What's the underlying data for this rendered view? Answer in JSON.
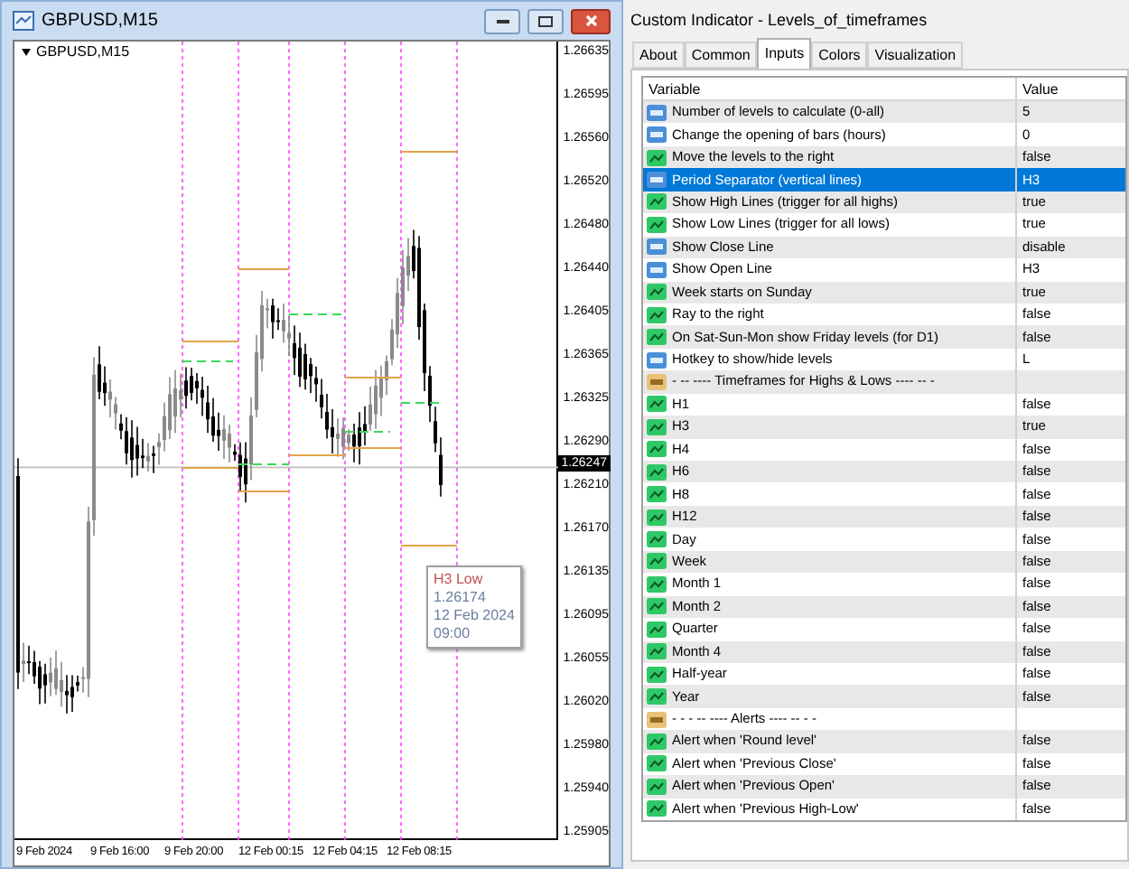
{
  "chart_window": {
    "title": "GBPUSD,M15",
    "symbol_label": "GBPUSD,M15",
    "price_ticks": [
      "1.26635",
      "1.26595",
      "1.26560",
      "1.26520",
      "1.26480",
      "1.26440",
      "1.26405",
      "1.26365",
      "1.26325",
      "1.26290",
      "1.26210",
      "1.26170",
      "1.26135",
      "1.26095",
      "1.26055",
      "1.26020",
      "1.25980",
      "1.25940",
      "1.25905"
    ],
    "current_price": "1.26247",
    "time_labels": [
      "9 Feb 2024",
      "9 Feb 16:00",
      "9 Feb 20:00",
      "12 Feb 00:15",
      "12 Feb 04:15",
      "12 Feb 08:15"
    ],
    "tooltip": {
      "title": "H3 Low",
      "price": "1.26174",
      "date": "12 Feb 2024",
      "time": "09:00"
    }
  },
  "dialog": {
    "title": "Custom Indicator - Levels_of_timeframes",
    "tabs": [
      {
        "label": "About",
        "selected": false
      },
      {
        "label": "Common",
        "selected": false
      },
      {
        "label": "Inputs",
        "selected": true
      },
      {
        "label": "Colors",
        "selected": false
      },
      {
        "label": "Visualization",
        "selected": false
      }
    ],
    "table": {
      "columns": [
        "Variable",
        "Value"
      ],
      "rows": [
        {
          "kind": "number",
          "variable": "Number of levels to calculate (0-all)",
          "value": "5",
          "selected": false
        },
        {
          "kind": "number",
          "variable": "Change the opening of bars (hours)",
          "value": "0",
          "selected": false
        },
        {
          "kind": "bool",
          "variable": "Move the levels to the right",
          "value": "false",
          "selected": false
        },
        {
          "kind": "number",
          "variable": "Period Separator (vertical lines)",
          "value": "H3",
          "selected": true
        },
        {
          "kind": "bool",
          "variable": "Show High Lines (trigger for all highs)",
          "value": "true",
          "selected": false
        },
        {
          "kind": "bool",
          "variable": "Show Low Lines (trigger for all lows)",
          "value": "true",
          "selected": false
        },
        {
          "kind": "number",
          "variable": "Show Close Line",
          "value": "disable",
          "selected": false
        },
        {
          "kind": "number",
          "variable": "Show Open Line",
          "value": "H3",
          "selected": false
        },
        {
          "kind": "bool",
          "variable": "Week starts on Sunday",
          "value": "true",
          "selected": false
        },
        {
          "kind": "bool",
          "variable": "Ray to the right",
          "value": "false",
          "selected": false
        },
        {
          "kind": "bool",
          "variable": "On Sat-Sun-Mon show Friday levels (for D1)",
          "value": "false",
          "selected": false
        },
        {
          "kind": "number",
          "variable": "Hotkey to show/hide levels",
          "value": "L",
          "selected": false
        },
        {
          "kind": "string",
          "variable": "-  -- ---- Timeframes for Highs & Lows ---- --  -",
          "selected": false
        },
        {
          "kind": "bool",
          "variable": "H1",
          "value": "false",
          "selected": false
        },
        {
          "kind": "bool",
          "variable": "H3",
          "value": "true",
          "selected": false
        },
        {
          "kind": "bool",
          "variable": "H4",
          "value": "false",
          "selected": false
        },
        {
          "kind": "bool",
          "variable": "H6",
          "value": "false",
          "selected": false
        },
        {
          "kind": "bool",
          "variable": "H8",
          "value": "false",
          "selected": false
        },
        {
          "kind": "bool",
          "variable": "H12",
          "value": "false",
          "selected": false
        },
        {
          "kind": "bool",
          "variable": "Day",
          "value": "false",
          "selected": false
        },
        {
          "kind": "bool",
          "variable": "Week",
          "value": "false",
          "selected": false
        },
        {
          "kind": "bool",
          "variable": "Month 1",
          "value": "false",
          "selected": false
        },
        {
          "kind": "bool",
          "variable": "Month 2",
          "value": "false",
          "selected": false
        },
        {
          "kind": "bool",
          "variable": "Quarter",
          "value": "false",
          "selected": false
        },
        {
          "kind": "bool",
          "variable": "Month 4",
          "value": "false",
          "selected": false
        },
        {
          "kind": "bool",
          "variable": "Half-year",
          "value": "false",
          "selected": false
        },
        {
          "kind": "bool",
          "variable": "Year",
          "value": "false",
          "selected": false
        },
        {
          "kind": "string",
          "variable": "-    -    - -- ---- Alerts ---- --  -    -",
          "selected": false
        },
        {
          "kind": "bool",
          "variable": "Alert when 'Round level'",
          "value": "false",
          "selected": false
        },
        {
          "kind": "bool",
          "variable": "Alert when 'Previous Close'",
          "value": "false",
          "selected": false
        },
        {
          "kind": "bool",
          "variable": "Alert when 'Previous Open'",
          "value": "false",
          "selected": false
        },
        {
          "kind": "bool",
          "variable": "Alert when 'Previous High-Low'",
          "value": "false",
          "selected": false
        }
      ]
    }
  }
}
